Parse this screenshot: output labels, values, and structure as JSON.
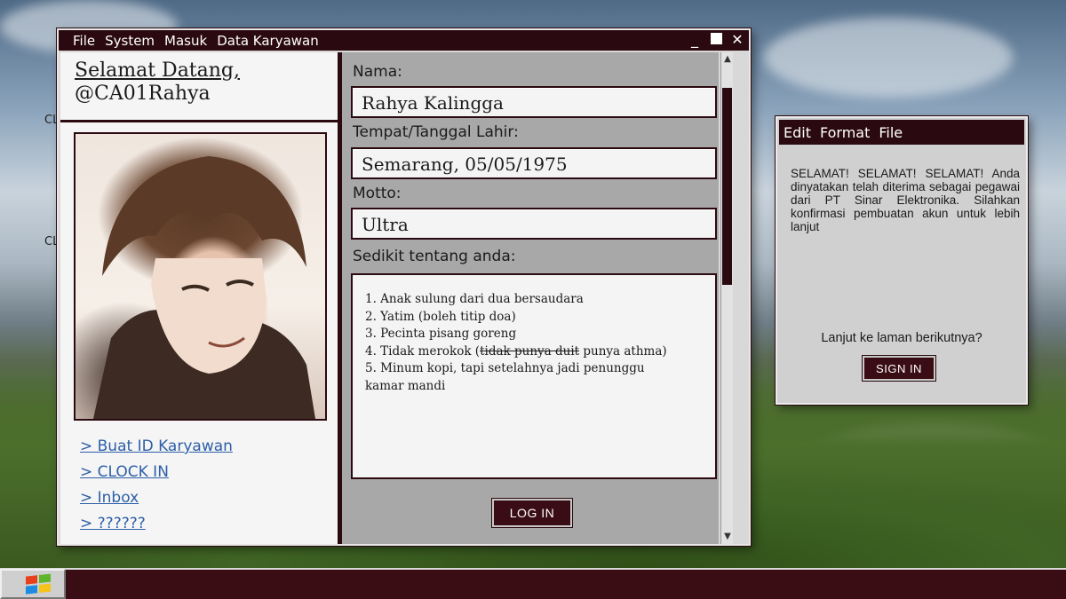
{
  "desktop": {
    "labels": [
      "CL",
      "CL"
    ]
  },
  "main_window": {
    "menu": [
      "File",
      "System",
      "Masuk",
      "Data Karyawan"
    ],
    "controls": {
      "minimize": "_",
      "close": "✕"
    },
    "welcome_line1": "Selamat Datang,",
    "welcome_line2": "@CA01Rahya",
    "links": [
      "> Buat ID Karyawan",
      "> CLOCK IN",
      "> Inbox",
      "> ??????"
    ],
    "form": {
      "name_label": "Nama:",
      "name_value": "Rahya Kalingga",
      "birth_label": "Tempat/Tanggal Lahir:",
      "birth_value": "Semarang, 05/05/1975",
      "motto_label": "Motto:",
      "motto_value": "Ultra",
      "about_label": "Sedikit tentang anda:",
      "about_items": {
        "1": "1. Anak sulung dari dua bersaudara",
        "2": "2. Yatim (boleh titip doa)",
        "3": "3. Pecinta pisang goreng",
        "4a": "4. Tidak merokok (",
        "4b": "tidak punya duit",
        "4c": " punya athma)",
        "5": "5. Minum kopi, tapi setelahnya jadi penunggu kamar mandi"
      },
      "login_label": "LOG IN"
    }
  },
  "dialog": {
    "menu": [
      "Edit",
      "Format",
      "File"
    ],
    "message": "SELAMAT! SELAMAT! SELAMAT! Anda dinyatakan telah diterima sebagai pegawai dari PT Sinar Elektronika. Silahkan konfirmasi pembuatan akun untuk lebih lanjut",
    "question": "Lanjut ke laman berikutnya?",
    "signin_label": "SIGN IN"
  },
  "colors": {
    "accent": "#2a0a10",
    "button": "#3a0d14",
    "link": "#2d5fa8"
  }
}
